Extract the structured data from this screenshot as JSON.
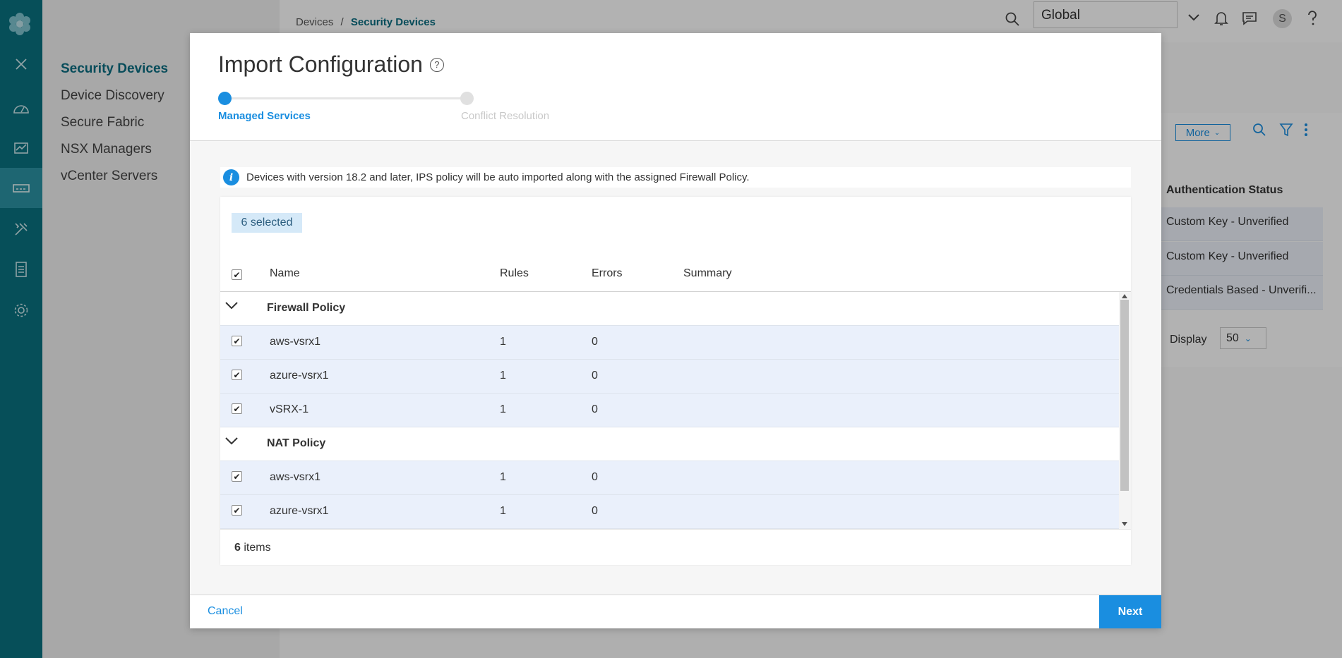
{
  "rail": {
    "icons": [
      "logo-icon",
      "close-icon",
      "dashboard-icon",
      "monitor-icon",
      "devices-icon",
      "tools-icon",
      "reports-icon",
      "settings-icon"
    ]
  },
  "subnav": {
    "items": [
      "Security Devices",
      "Device Discovery",
      "Secure Fabric",
      "NSX Managers",
      "vCenter Servers"
    ]
  },
  "breadcrumb": {
    "parent": "Devices",
    "sep": "/",
    "current": "Security Devices"
  },
  "topbar": {
    "domain": "Global",
    "user_initial": "S"
  },
  "background_grid": {
    "more_label": "More",
    "column_header": "Authentication Status",
    "rows": [
      "Custom Key - Unverified",
      "Custom Key - Unverified",
      "Credentials Based - Unverifi..."
    ],
    "display_label": "Display",
    "display_value": "50"
  },
  "modal": {
    "title": "Import Configuration",
    "help": "?",
    "steps": [
      "Managed Services",
      "Conflict Resolution"
    ],
    "info": "Devices with version 18.2 and later, IPS policy will be auto imported along with the assigned Firewall Policy.",
    "selected": "6 selected",
    "columns": {
      "name": "Name",
      "rules": "Rules",
      "errors": "Errors",
      "summary": "Summary"
    },
    "groups": [
      {
        "name": "Firewall Policy",
        "rows": [
          {
            "name": "aws-vsrx1",
            "rules": "1",
            "errors": "0"
          },
          {
            "name": "azure-vsrx1",
            "rules": "1",
            "errors": "0"
          },
          {
            "name": "vSRX-1",
            "rules": "1",
            "errors": "0"
          }
        ]
      },
      {
        "name": "NAT Policy",
        "rows": [
          {
            "name": "aws-vsrx1",
            "rules": "1",
            "errors": "0"
          },
          {
            "name": "azure-vsrx1",
            "rules": "1",
            "errors": "0"
          }
        ]
      }
    ],
    "items_count": "6",
    "items_label": "items",
    "cancel": "Cancel",
    "next": "Next"
  },
  "colors": {
    "rail": "#0a7280",
    "accent": "#1a8ee0",
    "row_selected": "#eaf0fb"
  }
}
